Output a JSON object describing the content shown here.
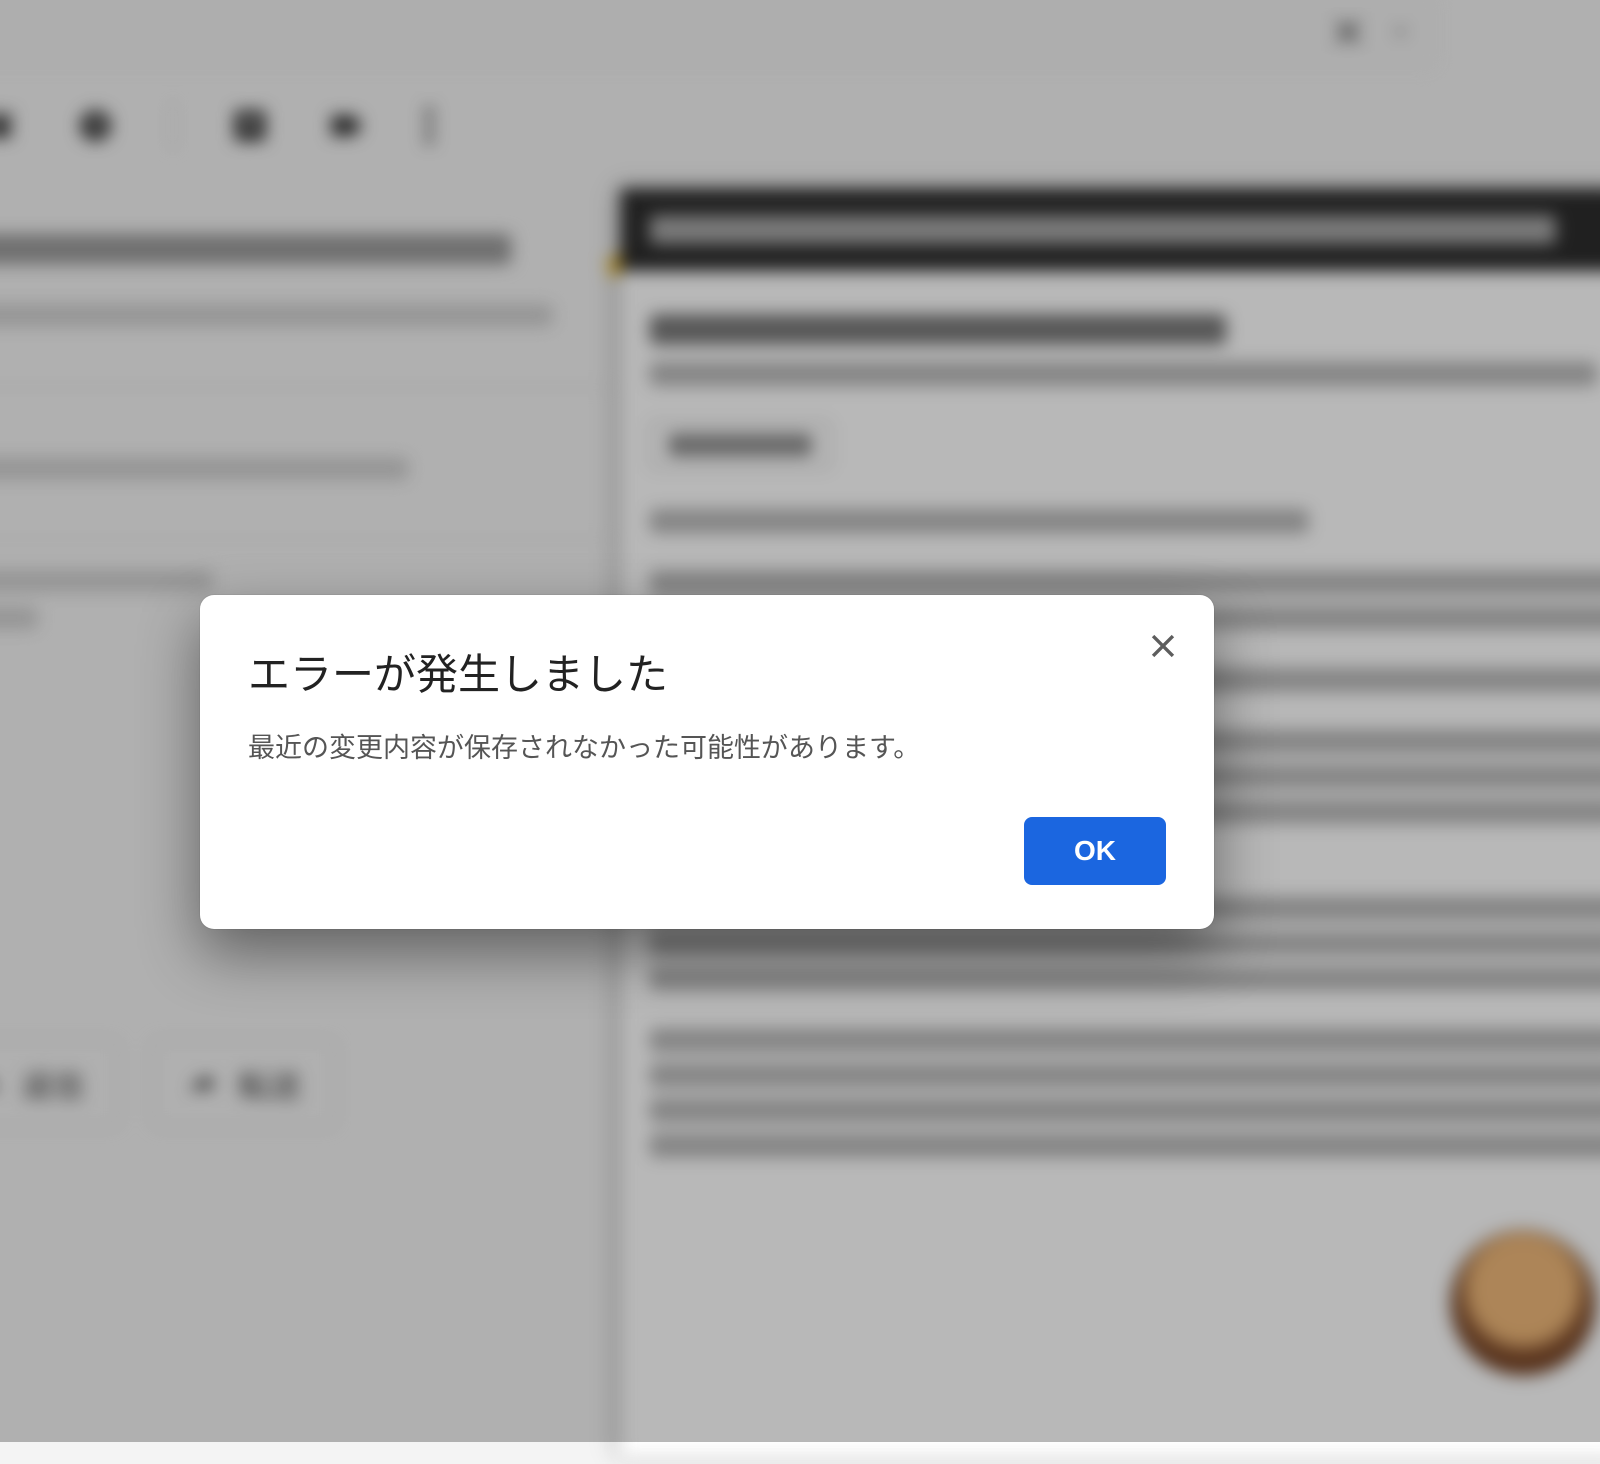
{
  "search": {
    "query": ""
  },
  "toolbar": {
    "archive_label": "archive",
    "snooze_label": "snooze",
    "move_label": "move-to-inbox",
    "label_label": "labels",
    "more_label": "more"
  },
  "actions": {
    "reply_label": "返信",
    "forward_label": "転送"
  },
  "dialog": {
    "title": "エラーが発生しました",
    "body": "最近の変更内容が保存されなかった可能性があります。",
    "ok_label": "OK"
  }
}
